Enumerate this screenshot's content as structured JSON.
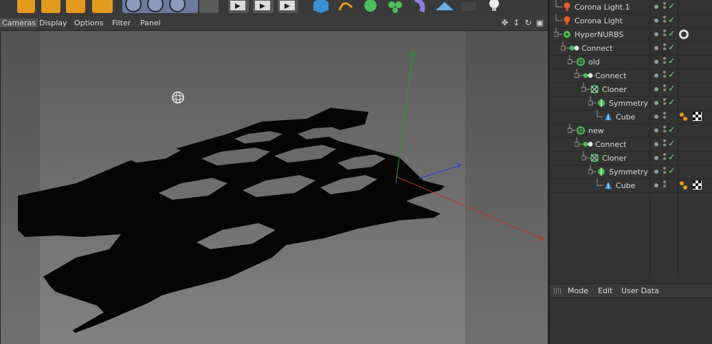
{
  "viewport_menu": {
    "items": [
      "Cameras",
      "Display",
      "Options",
      "Filter",
      "Panel"
    ],
    "active_index": 0
  },
  "object_manager": {
    "objects": [
      {
        "name": "Corona Light.1",
        "depth": 0,
        "icon": "light-icon"
      },
      {
        "name": "Corona Light",
        "depth": 0,
        "icon": "light-icon"
      },
      {
        "name": "HyperNURBS",
        "depth": 0,
        "icon": "hypernurbs-icon",
        "tag": "material-sphere"
      },
      {
        "name": "Connect",
        "depth": 1,
        "icon": "connect-icon"
      },
      {
        "name": "old",
        "depth": 2,
        "icon": "null-icon"
      },
      {
        "name": "Connect",
        "depth": 3,
        "icon": "connect-icon"
      },
      {
        "name": "Cloner",
        "depth": 4,
        "icon": "cloner-icon"
      },
      {
        "name": "Symmetry",
        "depth": 5,
        "icon": "symmetry-icon"
      },
      {
        "name": "Cube",
        "depth": 6,
        "icon": "cube-icon",
        "tag": "phong-checker"
      },
      {
        "name": "new",
        "depth": 2,
        "icon": "null-icon"
      },
      {
        "name": "Connect",
        "depth": 3,
        "icon": "connect-icon"
      },
      {
        "name": "Cloner",
        "depth": 4,
        "icon": "cloner-icon"
      },
      {
        "name": "Symmetry",
        "depth": 5,
        "icon": "symmetry-icon"
      },
      {
        "name": "Cube",
        "depth": 6,
        "icon": "cube-icon",
        "tag": "phong-checker"
      }
    ]
  },
  "attributes": {
    "menu": [
      "Mode",
      "Edit",
      "User Data"
    ]
  },
  "colors": {
    "x_axis": "#c0302a",
    "y_axis": "#1fa31f",
    "z_axis": "#2a3ad0",
    "check": "#66d966",
    "light_bulb": "#e0602a"
  }
}
